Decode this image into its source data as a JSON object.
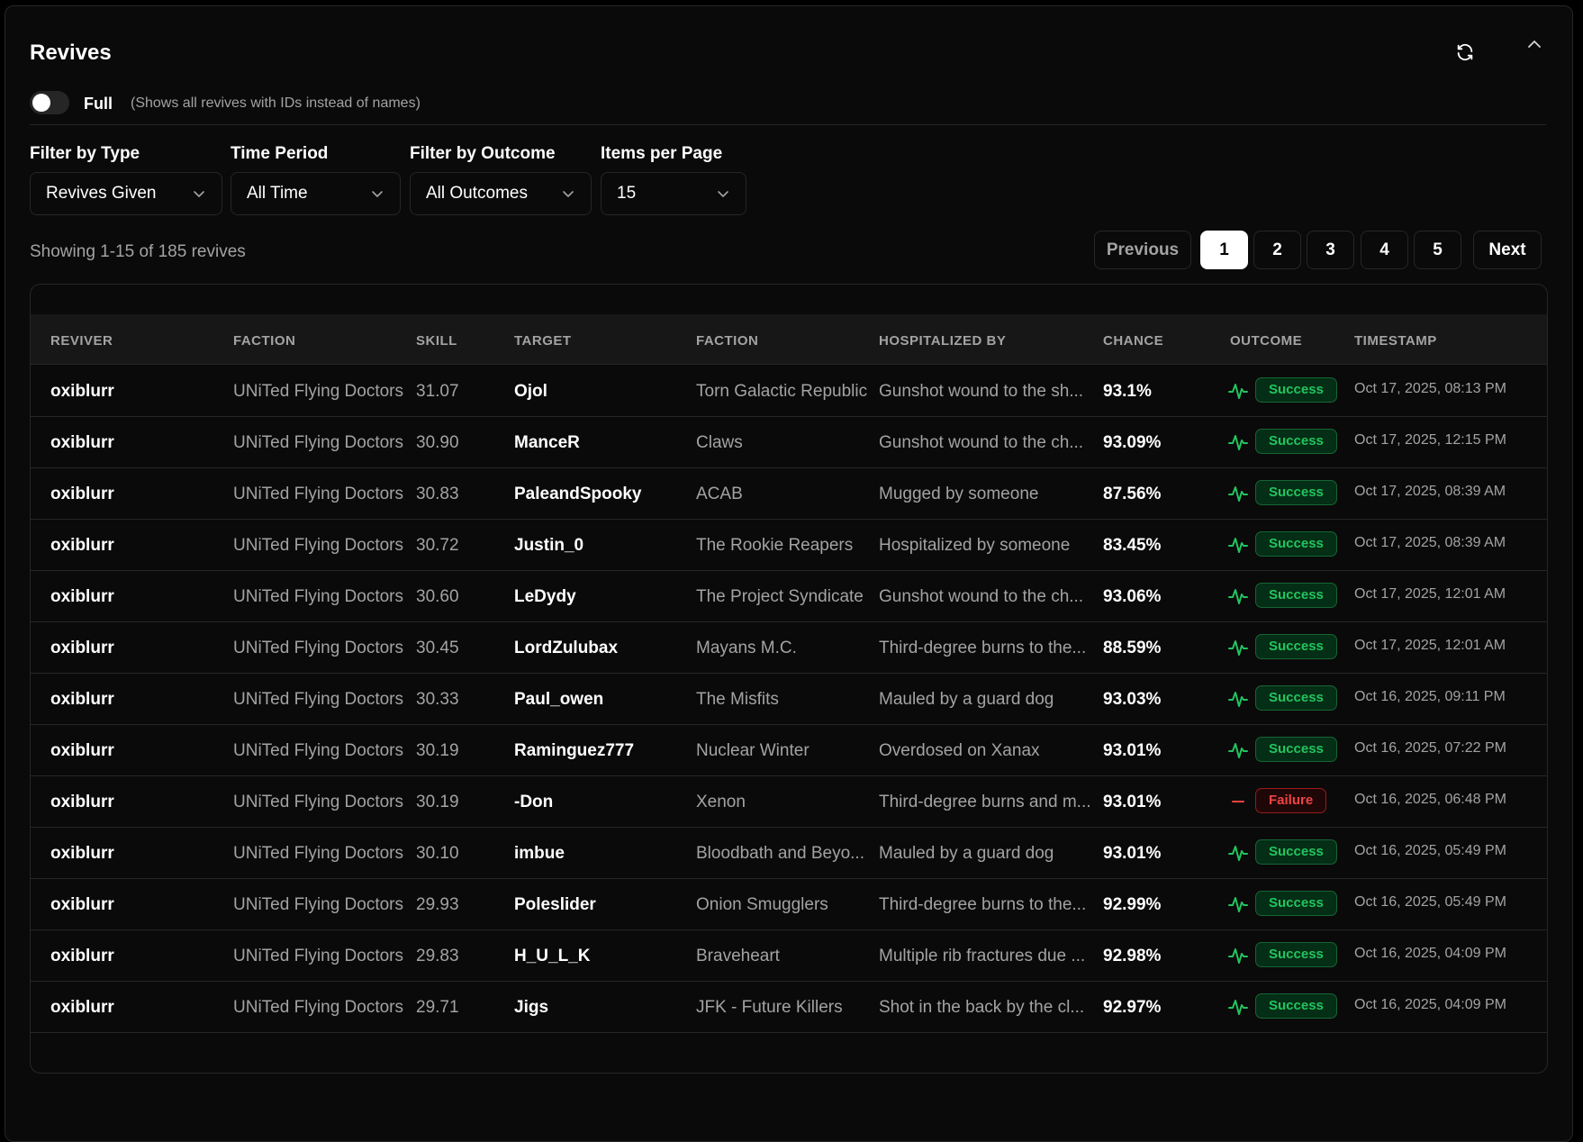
{
  "header": {
    "title": "Revives",
    "refresh_icon": "refresh-icon",
    "collapse_icon": "chevron-up-icon"
  },
  "toggle": {
    "label": "Full",
    "hint": "(Shows all revives with IDs instead of names)",
    "checked": false
  },
  "filters": {
    "type": {
      "label": "Filter by Type",
      "value": "Revives Given"
    },
    "period": {
      "label": "Time Period",
      "value": "All Time"
    },
    "outcome": {
      "label": "Filter by Outcome",
      "value": "All Outcomes"
    },
    "per_page": {
      "label": "Items per Page",
      "value": "15"
    }
  },
  "pagination": {
    "showing": "Showing 1-15 of 185 revives",
    "previous": "Previous",
    "next": "Next",
    "pages": [
      "1",
      "2",
      "3",
      "4",
      "5"
    ],
    "current": "1"
  },
  "table": {
    "columns": [
      "REVIVER",
      "FACTION",
      "SKILL",
      "TARGET",
      "FACTION",
      "HOSPITALIZED BY",
      "CHANCE",
      "OUTCOME",
      "TIMESTAMP"
    ],
    "rows": [
      {
        "reviver": "oxiblurr",
        "faction": "UNiTed Flying Doctors",
        "skill": "31.07",
        "target": "Ojol",
        "target_faction": "Torn Galactic Republic",
        "hospitalized_by": "Gunshot wound to the sh...",
        "chance": "93.1%",
        "outcome": "Success",
        "timestamp": "Oct 17, 2025, 08:13 PM"
      },
      {
        "reviver": "oxiblurr",
        "faction": "UNiTed Flying Doctors",
        "skill": "30.90",
        "target": "ManceR",
        "target_faction": "Claws",
        "hospitalized_by": "Gunshot wound to the ch...",
        "chance": "93.09%",
        "outcome": "Success",
        "timestamp": "Oct 17, 2025, 12:15 PM"
      },
      {
        "reviver": "oxiblurr",
        "faction": "UNiTed Flying Doctors",
        "skill": "30.83",
        "target": "PaleandSpooky",
        "target_faction": "ACAB",
        "hospitalized_by": "Mugged by someone",
        "chance": "87.56%",
        "outcome": "Success",
        "timestamp": "Oct 17, 2025, 08:39 AM"
      },
      {
        "reviver": "oxiblurr",
        "faction": "UNiTed Flying Doctors",
        "skill": "30.72",
        "target": "Justin_0",
        "target_faction": "The Rookie Reapers",
        "hospitalized_by": "Hospitalized by someone",
        "chance": "83.45%",
        "outcome": "Success",
        "timestamp": "Oct 17, 2025, 08:39 AM"
      },
      {
        "reviver": "oxiblurr",
        "faction": "UNiTed Flying Doctors",
        "skill": "30.60",
        "target": "LeDydy",
        "target_faction": "The Project Syndicate",
        "hospitalized_by": "Gunshot wound to the ch...",
        "chance": "93.06%",
        "outcome": "Success",
        "timestamp": "Oct 17, 2025, 12:01 AM"
      },
      {
        "reviver": "oxiblurr",
        "faction": "UNiTed Flying Doctors",
        "skill": "30.45",
        "target": "LordZulubax",
        "target_faction": "Mayans M.C.",
        "hospitalized_by": "Third-degree burns to the...",
        "chance": "88.59%",
        "outcome": "Success",
        "timestamp": "Oct 17, 2025, 12:01 AM"
      },
      {
        "reviver": "oxiblurr",
        "faction": "UNiTed Flying Doctors",
        "skill": "30.33",
        "target": "Paul_owen",
        "target_faction": "The Misfits",
        "hospitalized_by": "Mauled by a guard dog",
        "chance": "93.03%",
        "outcome": "Success",
        "timestamp": "Oct 16, 2025, 09:11 PM"
      },
      {
        "reviver": "oxiblurr",
        "faction": "UNiTed Flying Doctors",
        "skill": "30.19",
        "target": "Raminguez777",
        "target_faction": "Nuclear Winter",
        "hospitalized_by": "Overdosed on Xanax",
        "chance": "93.01%",
        "outcome": "Success",
        "timestamp": "Oct 16, 2025, 07:22 PM"
      },
      {
        "reviver": "oxiblurr",
        "faction": "UNiTed Flying Doctors",
        "skill": "30.19",
        "target": "-Don",
        "target_faction": "Xenon",
        "hospitalized_by": "Third-degree burns and m...",
        "chance": "93.01%",
        "outcome": "Failure",
        "timestamp": "Oct 16, 2025, 06:48 PM"
      },
      {
        "reviver": "oxiblurr",
        "faction": "UNiTed Flying Doctors",
        "skill": "30.10",
        "target": "imbue",
        "target_faction": "Bloodbath and Beyo...",
        "hospitalized_by": "Mauled by a guard dog",
        "chance": "93.01%",
        "outcome": "Success",
        "timestamp": "Oct 16, 2025, 05:49 PM"
      },
      {
        "reviver": "oxiblurr",
        "faction": "UNiTed Flying Doctors",
        "skill": "29.93",
        "target": "Poleslider",
        "target_faction": "Onion Smugglers",
        "hospitalized_by": "Third-degree burns to the...",
        "chance": "92.99%",
        "outcome": "Success",
        "timestamp": "Oct 16, 2025, 05:49 PM"
      },
      {
        "reviver": "oxiblurr",
        "faction": "UNiTed Flying Doctors",
        "skill": "29.83",
        "target": "H_U_L_K",
        "target_faction": "Braveheart",
        "hospitalized_by": "Multiple rib fractures due ...",
        "chance": "92.98%",
        "outcome": "Success",
        "timestamp": "Oct 16, 2025, 04:09 PM"
      },
      {
        "reviver": "oxiblurr",
        "faction": "UNiTed Flying Doctors",
        "skill": "29.71",
        "target": "Jigs",
        "target_faction": "JFK - Future Killers",
        "hospitalized_by": "Shot in the back by the cl...",
        "chance": "92.97%",
        "outcome": "Success",
        "timestamp": "Oct 16, 2025, 04:09 PM"
      }
    ]
  },
  "colors": {
    "success": "#22c55e",
    "failure": "#ef4444",
    "background": "#0a0a0a",
    "border": "#262626"
  }
}
